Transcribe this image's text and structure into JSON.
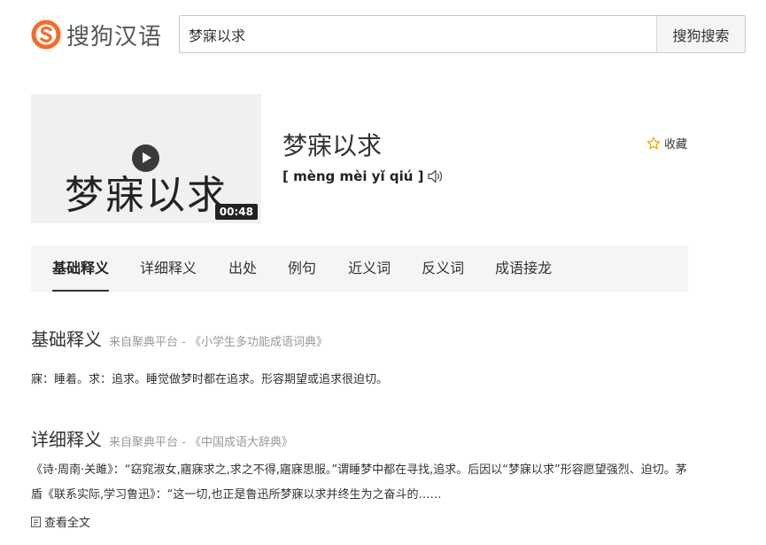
{
  "header": {
    "logo_text": "搜狗汉语",
    "search_value": "梦寐以求",
    "search_button": "搜狗搜索"
  },
  "video": {
    "title_text": "梦寐以求",
    "duration": "00:48"
  },
  "word": {
    "title": "梦寐以求",
    "pinyin": "[ mèng mèi yǐ qiú ]",
    "favorite_label": "收藏"
  },
  "tabs": [
    "基础释义",
    "详细释义",
    "出处",
    "例句",
    "近义词",
    "反义词",
    "成语接龙"
  ],
  "active_tab": "基础释义",
  "sections": {
    "basic": {
      "title": "基础释义",
      "source": "来自聚典平台 - 《小学生多功能成语词典》",
      "text": "寐：睡着。求：追求。睡觉做梦时都在追求。形容期望或追求很迫切。"
    },
    "detail": {
      "title": "详细释义",
      "source": "来自聚典平台 - 《中国成语大辞典》",
      "text": "《诗·周南·关雎》：“窈窕淑女,寤寐求之,求之不得,寤寐思服。”谓睡梦中都在寻找,追求。后因以“梦寐以求”形容愿望强烈、迫切。茅盾《联系实际,学习鲁迅》：“这一切,也正是鲁迅所梦寐以求并终生为之奋斗的……",
      "view_all": "查看全文"
    }
  },
  "colors": {
    "brand_orange": "#f56c2a",
    "tab_bg": "#f5f5f5",
    "muted_text": "#999999"
  }
}
